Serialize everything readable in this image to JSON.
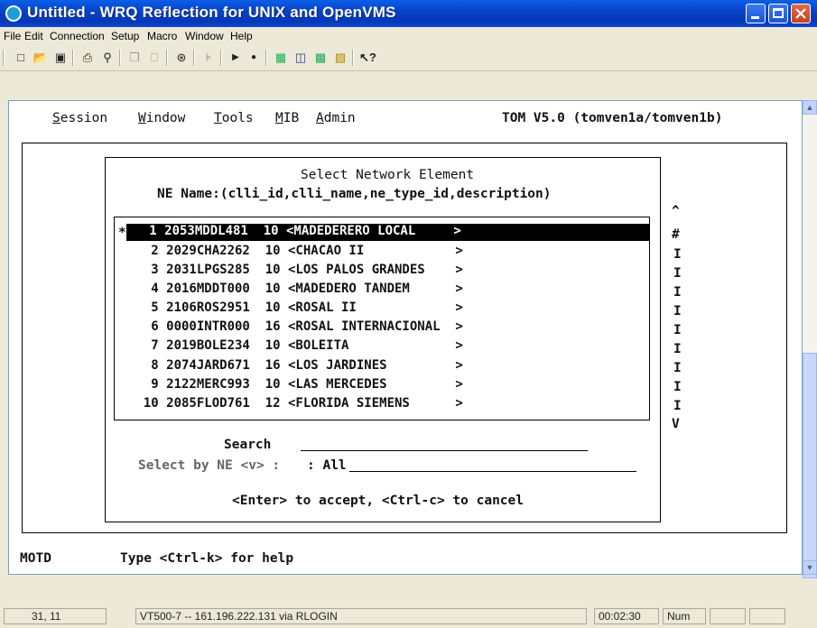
{
  "window": {
    "title": "Untitled - WRQ Reflection for UNIX and OpenVMS",
    "buttons": [
      "minimize",
      "maximize",
      "close"
    ]
  },
  "menubar": [
    "File",
    "Edit",
    "Connection",
    "Setup",
    "Macro",
    "Window",
    "Help"
  ],
  "toolbar": {
    "icons": [
      "new-icon",
      "open-icon",
      "save-icon",
      "print-icon",
      "find-icon",
      "copy-icon",
      "paste-icon",
      "connect-icon",
      "disconnect-icon",
      "play-icon",
      "record-icon",
      "setup-icon-1",
      "setup-icon-2",
      "setup-icon-3",
      "setup-icon-4",
      "help-icon"
    ]
  },
  "terminal": {
    "menu": [
      "Session",
      "Window",
      "Tools",
      "MIB",
      "Admin"
    ],
    "menu_hotkeys": [
      "S",
      "W",
      "T",
      "M",
      "A"
    ],
    "version": "TOM V5.0 (tomven1a/tomven1b)",
    "dialog": {
      "title": "Select Network Element",
      "subtitle": "NE Name:(clli_id,clli_name,ne_type_id,description)",
      "marker": "*",
      "rows": [
        {
          "num": "1",
          "id": "2053MDDL481",
          "type": "10",
          "name": "<MADEDERERO LOCAL",
          "end": ">"
        },
        {
          "num": "2",
          "id": "2029CHA2262",
          "type": "10",
          "name": "<CHACAO II",
          "end": ">"
        },
        {
          "num": "3",
          "id": "2031LPGS285",
          "type": "10",
          "name": "<LOS PALOS GRANDES",
          "end": ">"
        },
        {
          "num": "4",
          "id": "2016MDDT000",
          "type": "10",
          "name": "<MADEDERO TANDEM",
          "end": ">"
        },
        {
          "num": "5",
          "id": "2106ROS2951",
          "type": "10",
          "name": "<ROSAL II",
          "end": ">"
        },
        {
          "num": "6",
          "id": "0000INTR000",
          "type": "16",
          "name": "<ROSAL INTERNACIONAL",
          "end": ">"
        },
        {
          "num": "7",
          "id": "2019BOLE234",
          "type": "10",
          "name": "<BOLEITA",
          "end": ">"
        },
        {
          "num": "8",
          "id": "2074JARD671",
          "type": "16",
          "name": "<LOS JARDINES",
          "end": ">"
        },
        {
          "num": "9",
          "id": "2122MERC993",
          "type": "10",
          "name": "<LAS MERCEDES",
          "end": ">"
        },
        {
          "num": "10",
          "id": "2085FLOD761",
          "type": "12",
          "name": "<FLORIDA SIEMENS",
          "end": ">"
        }
      ],
      "scroll_up": "^",
      "scroll_hash": "#",
      "scroll_bar": "I",
      "scroll_down": "V",
      "search_label": "Search",
      "search_value": "",
      "select_label": "Select by NE <v> :",
      "select_value": ": All",
      "footer": "<Enter> to accept, <Ctrl-c> to cancel"
    },
    "motd_label": "MOTD",
    "help_text": "Type <Ctrl-k> for help"
  },
  "statusbar": {
    "cursor": "31, 11",
    "connection": "VT500-7 -- 161.196.222.131 via RLOGIN",
    "timer": "00:02:30",
    "num": "Num"
  }
}
